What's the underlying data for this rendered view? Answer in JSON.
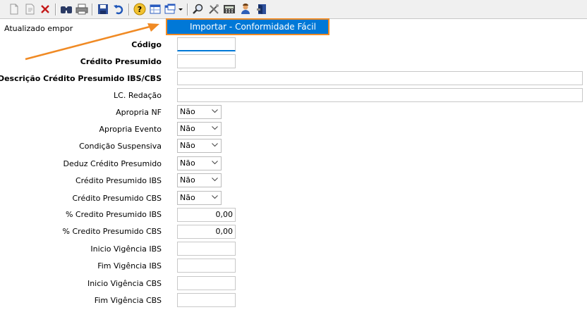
{
  "status": {
    "updated_label": "Atualizado em:",
    "by_label": "por"
  },
  "menu": {
    "import_label": "Importar - Conformidade Fácil"
  },
  "colors": {
    "accent": "#0078d7",
    "highlight": "#f08a24"
  },
  "toolbar": {
    "icons": [
      "new-icon",
      "edit-icon",
      "delete-icon",
      "find-icon",
      "print-icon",
      "save-icon",
      "undo-icon",
      "help-icon",
      "table-icon",
      "window-dropdown-icon",
      "search-icon",
      "tools-icon",
      "calculator-icon",
      "user-icon",
      "exit-icon"
    ]
  },
  "form": {
    "codigo": {
      "label": "Código",
      "value": ""
    },
    "credito_presumido": {
      "label": "Crédito Presumido",
      "value": ""
    },
    "descricao": {
      "label": "Descrição Crédito Presumido IBS/CBS",
      "value": ""
    },
    "lc_redacao": {
      "label": "LC. Redação",
      "value": ""
    },
    "apropria_nf": {
      "label": "Apropria NF",
      "value": "Não"
    },
    "apropria_evento": {
      "label": "Apropria Evento",
      "value": "Não"
    },
    "condicao_suspensiva": {
      "label": "Condição Suspensiva",
      "value": "Não"
    },
    "deduz_credito": {
      "label": "Deduz Crédito Presumido",
      "value": "Não"
    },
    "credito_ibs": {
      "label": "Crédito Presumido IBS",
      "value": "Não"
    },
    "credito_cbs": {
      "label": "Crédito Presumido CBS",
      "value": "Não"
    },
    "pct_ibs": {
      "label": "% Credito Presumido IBS",
      "value": "0,00"
    },
    "pct_cbs": {
      "label": "% Credito Presumido CBS",
      "value": "0,00"
    },
    "inicio_ibs": {
      "label": "Inicio Vigência IBS",
      "value": ""
    },
    "fim_ibs": {
      "label": "Fim Vigência IBS",
      "value": ""
    },
    "inicio_cbs": {
      "label": "Inicio Vigência CBS",
      "value": ""
    },
    "fim_cbs": {
      "label": "Fim Vigência CBS",
      "value": ""
    }
  }
}
